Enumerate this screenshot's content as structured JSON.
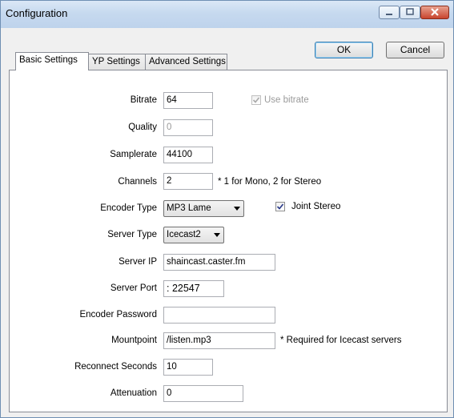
{
  "window": {
    "title": "Configuration"
  },
  "buttons": {
    "ok": "OK",
    "cancel": "Cancel"
  },
  "tabs": [
    {
      "label": "Basic Settings",
      "active": true
    },
    {
      "label": "YP Settings",
      "active": false
    },
    {
      "label": "Advanced Settings",
      "active": false
    }
  ],
  "form": {
    "bitrate": {
      "label": "Bitrate",
      "value": "64"
    },
    "use_bitrate": {
      "label": "Use bitrate",
      "checked": true,
      "enabled": false
    },
    "quality": {
      "label": "Quality",
      "value": "0"
    },
    "samplerate": {
      "label": "Samplerate",
      "value": "44100"
    },
    "channels": {
      "label": "Channels",
      "value": "2",
      "note": "* 1 for Mono, 2 for Stereo"
    },
    "encoder_type": {
      "label": "Encoder Type",
      "value": "MP3 Lame"
    },
    "joint_stereo": {
      "label": "Joint Stereo",
      "checked": true
    },
    "server_type": {
      "label": "Server Type",
      "value": "Icecast2"
    },
    "server_ip": {
      "label": "Server IP",
      "value": "shaincast.caster.fm"
    },
    "server_port": {
      "label": "Server Port",
      "value": ": 22547"
    },
    "encoder_password": {
      "label": "Encoder Password",
      "value": ""
    },
    "mountpoint": {
      "label": "Mountpoint",
      "value": "/listen.mp3",
      "note": "* Required for Icecast servers"
    },
    "reconnect_seconds": {
      "label": "Reconnect Seconds",
      "value": "10"
    },
    "attenuation": {
      "label": "Attenuation",
      "value": "0"
    }
  }
}
